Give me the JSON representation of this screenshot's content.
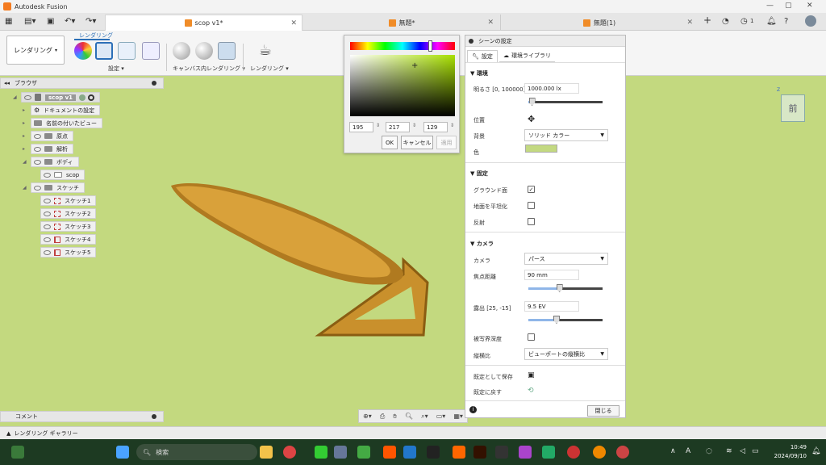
{
  "app": {
    "title": "Autodesk Fusion"
  },
  "tabs": [
    {
      "label": "scop v1*"
    },
    {
      "label": "無題*"
    },
    {
      "label": "無題(1)"
    }
  ],
  "tab_badge": "1",
  "ribbon": {
    "workspace": "レンダリング",
    "active_tab": "レンダリング",
    "group_setup": "設定",
    "group_canvas": "キャンバス内レンダリング",
    "group_render": "レンダリング"
  },
  "browser": {
    "title": "ブラウザ",
    "root": "scop v1",
    "items": [
      "ドキュメントの設定",
      "名前の付いたビュー",
      "原点",
      "解析",
      "ボディ",
      "scop",
      "スケッチ",
      "スケッチ1",
      "スケッチ2",
      "スケッチ3",
      "スケッチ4",
      "スケッチ5"
    ]
  },
  "comment": {
    "label": "コメント"
  },
  "gallery": {
    "label": "レンダリング ギャラリー"
  },
  "color_picker": {
    "r": "195",
    "g": "217",
    "b": "129",
    "ok": "OK",
    "cancel": "キャンセル",
    "apply": "適用"
  },
  "settings": {
    "title": "シーンの設定",
    "tab_settings": "設定",
    "tab_library": "環境ライブラリ",
    "env_header": "環境",
    "brightness_label": "明るさ [0, 100000]",
    "brightness_value": "1000.000 lx",
    "position_label": "位置",
    "background_label": "背景",
    "background_value": "ソリッド カラー",
    "color_label": "色",
    "color_swatch": "#c3d981",
    "ground_header": "固定",
    "ground_plane_label": "グラウンド面",
    "flatten_label": "地面を平坦化",
    "reflect_label": "反射",
    "camera_header": "カメラ",
    "camera_label": "カメラ",
    "camera_value": "パース",
    "focal_label": "焦点距離",
    "focal_value": "90 mm",
    "exposure_label": "露出 [25, -15]",
    "exposure_value": "9.5 EV",
    "dof_label": "被写界深度",
    "aspect_label": "縦横比",
    "aspect_value": "ビューポートの縦横比",
    "save_default_label": "既定として保存",
    "restore_default_label": "既定に戻す",
    "close_label": "閉じる",
    "brightness_fraction": 0.05,
    "focal_fraction": 0.42,
    "exposure_fraction": 0.38
  },
  "viewcube": {
    "face": "前"
  },
  "taskbar": {
    "search_placeholder": "検索",
    "time": "10:49",
    "date": "2024/09/10",
    "tray_a": "A"
  },
  "colors": {
    "viewport_bg": "#c3d97f",
    "accent": "#2c6fb7",
    "spoon": "#c9902c"
  }
}
